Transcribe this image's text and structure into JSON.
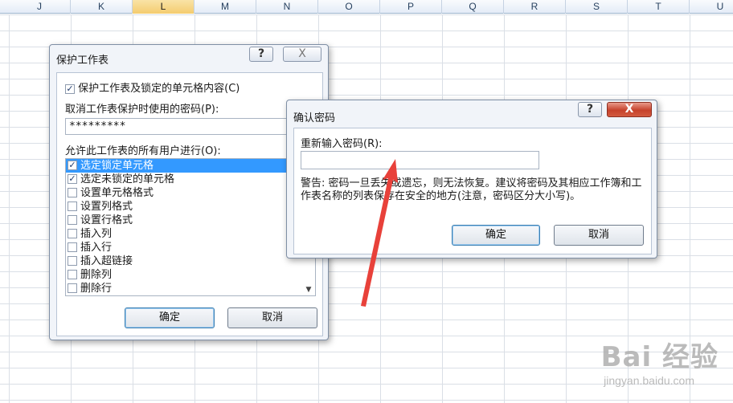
{
  "sheet": {
    "columns": [
      "J",
      "K",
      "L",
      "M",
      "N",
      "O",
      "P",
      "Q",
      "R",
      "S",
      "T",
      "U"
    ],
    "active_column": "L"
  },
  "protect_dialog": {
    "title": "保护工作表",
    "help_label": "?",
    "close_label": "X",
    "protect_checkbox": {
      "label": "保护工作表及锁定的单元格内容(C)",
      "checked": true
    },
    "password_label": "取消工作表保护时使用的密码(P):",
    "password_value": "*********",
    "allow_label": "允许此工作表的所有用户进行(O):",
    "permissions": [
      {
        "label": "选定锁定单元格",
        "checked": true,
        "selected": true
      },
      {
        "label": "选定未锁定的单元格",
        "checked": true,
        "selected": false
      },
      {
        "label": "设置单元格格式",
        "checked": false,
        "selected": false
      },
      {
        "label": "设置列格式",
        "checked": false,
        "selected": false
      },
      {
        "label": "设置行格式",
        "checked": false,
        "selected": false
      },
      {
        "label": "插入列",
        "checked": false,
        "selected": false
      },
      {
        "label": "插入行",
        "checked": false,
        "selected": false
      },
      {
        "label": "插入超链接",
        "checked": false,
        "selected": false
      },
      {
        "label": "删除列",
        "checked": false,
        "selected": false
      },
      {
        "label": "删除行",
        "checked": false,
        "selected": false
      }
    ],
    "scroll_down": "▼",
    "ok_label": "确定",
    "cancel_label": "取消"
  },
  "confirm_dialog": {
    "title": "确认密码",
    "help_label": "?",
    "close_label": "X",
    "reenter_label": "重新输入密码(R):",
    "password_value": "",
    "warning": "警告: 密码一旦丢失或遗忘，则无法恢复。建议将密码及其相应工作簿和工作表名称的列表保存在安全的地方(注意，密码区分大小写)。",
    "ok_label": "确定",
    "cancel_label": "取消"
  },
  "annotation": {
    "arrow_color": "#e8413a"
  },
  "watermark": {
    "logo": "Bai 经验",
    "url": "jingyan.baidu.com"
  }
}
